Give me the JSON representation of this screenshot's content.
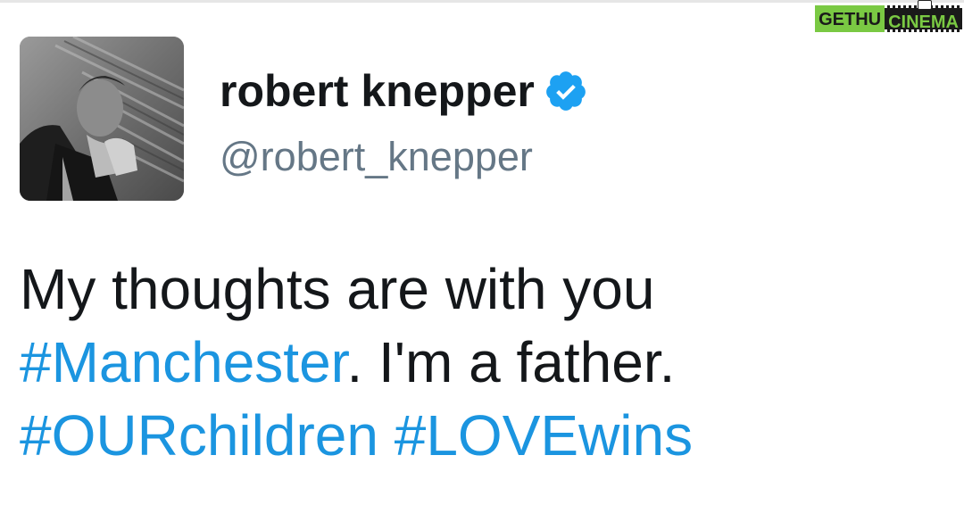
{
  "watermark": {
    "part1": "GETHU",
    "part2": "CINEMA"
  },
  "profile": {
    "display_name": "robert knepper",
    "handle": "@robert_knepper",
    "verified": true,
    "verified_icon": "verified-badge-icon",
    "avatar_description": "avatar"
  },
  "tweet": {
    "line1": "My thoughts are with you",
    "line2_hashtag": "#Manchester",
    "line2_text": ". I'm a father.",
    "line3_hashtag1": "#OURchildren",
    "line3_space": " ",
    "line3_hashtag2": "#LOVEwins"
  },
  "colors": {
    "hashtag": "#1b95e0",
    "verified": "#1da1f2",
    "handle": "#657786",
    "text": "#14171a",
    "watermark_green": "#7ac943"
  }
}
